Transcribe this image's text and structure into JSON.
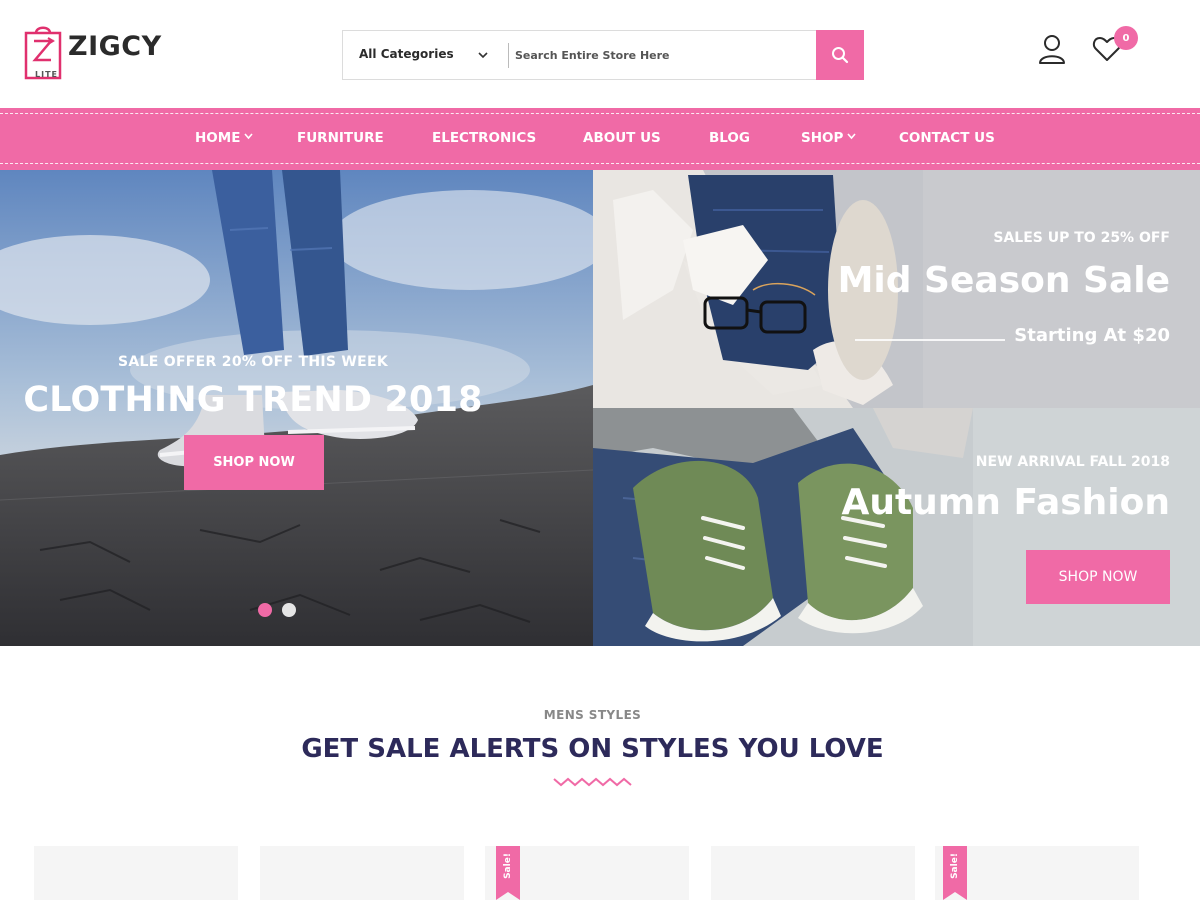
{
  "brand": {
    "name": "ZIGCY",
    "edition": "LITE",
    "accent_color": "#f06aa6"
  },
  "search": {
    "category_label": "All Categories",
    "placeholder": "Search Entire Store Here",
    "value": ""
  },
  "header": {
    "wishlist_count": "0"
  },
  "nav": {
    "items": [
      {
        "label": "HOME",
        "has_dropdown": true
      },
      {
        "label": "FURNITURE",
        "has_dropdown": false
      },
      {
        "label": "ELECTRONICS",
        "has_dropdown": false
      },
      {
        "label": "ABOUT US",
        "has_dropdown": false
      },
      {
        "label": "BLOG",
        "has_dropdown": false
      },
      {
        "label": "SHOP",
        "has_dropdown": true
      },
      {
        "label": "CONTACT US",
        "has_dropdown": false
      }
    ]
  },
  "hero": {
    "main_slide": {
      "subtitle": "SALE OFFER 20% OFF THIS WEEK",
      "title": "CLOTHING TREND 2018",
      "button": "SHOP NOW",
      "slide_count": 2,
      "active_slide": 1
    },
    "banner_top": {
      "subtitle": "SALES UP TO 25% OFF",
      "title": "Mid Season Sale",
      "price_text": "Starting At $20"
    },
    "banner_bottom": {
      "subtitle": "NEW ARRIVAL FALL 2018",
      "title": "Autumn Fashion",
      "button": "SHOP NOW"
    }
  },
  "section": {
    "eyebrow": "MENS STYLES",
    "title": "GET SALE ALERTS ON STYLES YOU LOVE"
  },
  "products": {
    "sale_badge": "Sale!",
    "cards": [
      {
        "on_sale": false
      },
      {
        "on_sale": false
      },
      {
        "on_sale": true
      },
      {
        "on_sale": false
      },
      {
        "on_sale": true
      }
    ]
  }
}
